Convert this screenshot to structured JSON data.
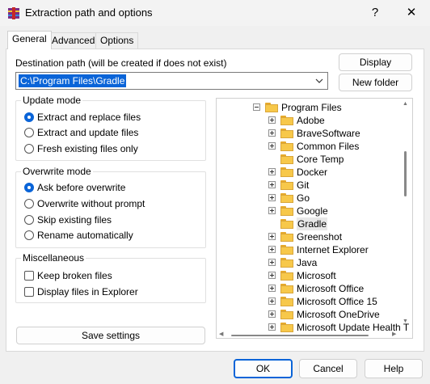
{
  "window": {
    "title": "Extraction path and options",
    "help_label": "?",
    "close_label": "✕"
  },
  "tabs": [
    {
      "label": "General",
      "active": true
    },
    {
      "label": "Advanced",
      "active": false
    },
    {
      "label": "Options",
      "active": false
    }
  ],
  "destination": {
    "label": "Destination path (will be created if does not exist)",
    "value": "C:\\Program Files\\Gradle",
    "display_button": "Display",
    "new_folder_button": "New folder"
  },
  "update_mode": {
    "title": "Update mode",
    "options": [
      {
        "label": "Extract and replace files",
        "selected": true
      },
      {
        "label": "Extract and update files",
        "selected": false
      },
      {
        "label": "Fresh existing files only",
        "selected": false
      }
    ]
  },
  "overwrite_mode": {
    "title": "Overwrite mode",
    "options": [
      {
        "label": "Ask before overwrite",
        "selected": true
      },
      {
        "label": "Overwrite without prompt",
        "selected": false
      },
      {
        "label": "Skip existing files",
        "selected": false
      },
      {
        "label": "Rename automatically",
        "selected": false
      }
    ]
  },
  "misc": {
    "title": "Miscellaneous",
    "options": [
      {
        "label": "Keep broken files",
        "checked": false
      },
      {
        "label": "Display files in Explorer",
        "checked": false
      }
    ]
  },
  "save_settings_button": "Save settings",
  "tree": {
    "parent": "Program Files",
    "items": [
      {
        "label": "Adobe",
        "expandable": true,
        "selected": false
      },
      {
        "label": "BraveSoftware",
        "expandable": true,
        "selected": false
      },
      {
        "label": "Common Files",
        "expandable": true,
        "selected": false
      },
      {
        "label": "Core Temp",
        "expandable": false,
        "selected": false
      },
      {
        "label": "Docker",
        "expandable": true,
        "selected": false
      },
      {
        "label": "Git",
        "expandable": true,
        "selected": false
      },
      {
        "label": "Go",
        "expandable": true,
        "selected": false
      },
      {
        "label": "Google",
        "expandable": true,
        "selected": false
      },
      {
        "label": "Gradle",
        "expandable": false,
        "selected": true
      },
      {
        "label": "Greenshot",
        "expandable": true,
        "selected": false
      },
      {
        "label": "Internet Explorer",
        "expandable": true,
        "selected": false
      },
      {
        "label": "Java",
        "expandable": true,
        "selected": false
      },
      {
        "label": "Microsoft",
        "expandable": true,
        "selected": false
      },
      {
        "label": "Microsoft Office",
        "expandable": true,
        "selected": false
      },
      {
        "label": "Microsoft Office 15",
        "expandable": true,
        "selected": false
      },
      {
        "label": "Microsoft OneDrive",
        "expandable": true,
        "selected": false
      },
      {
        "label": "Microsoft Update Health T",
        "expandable": true,
        "selected": false
      }
    ]
  },
  "footer": {
    "ok": "OK",
    "cancel": "Cancel",
    "help": "Help"
  },
  "colors": {
    "accent": "#0a64d8",
    "folder": "#f7c84a"
  }
}
